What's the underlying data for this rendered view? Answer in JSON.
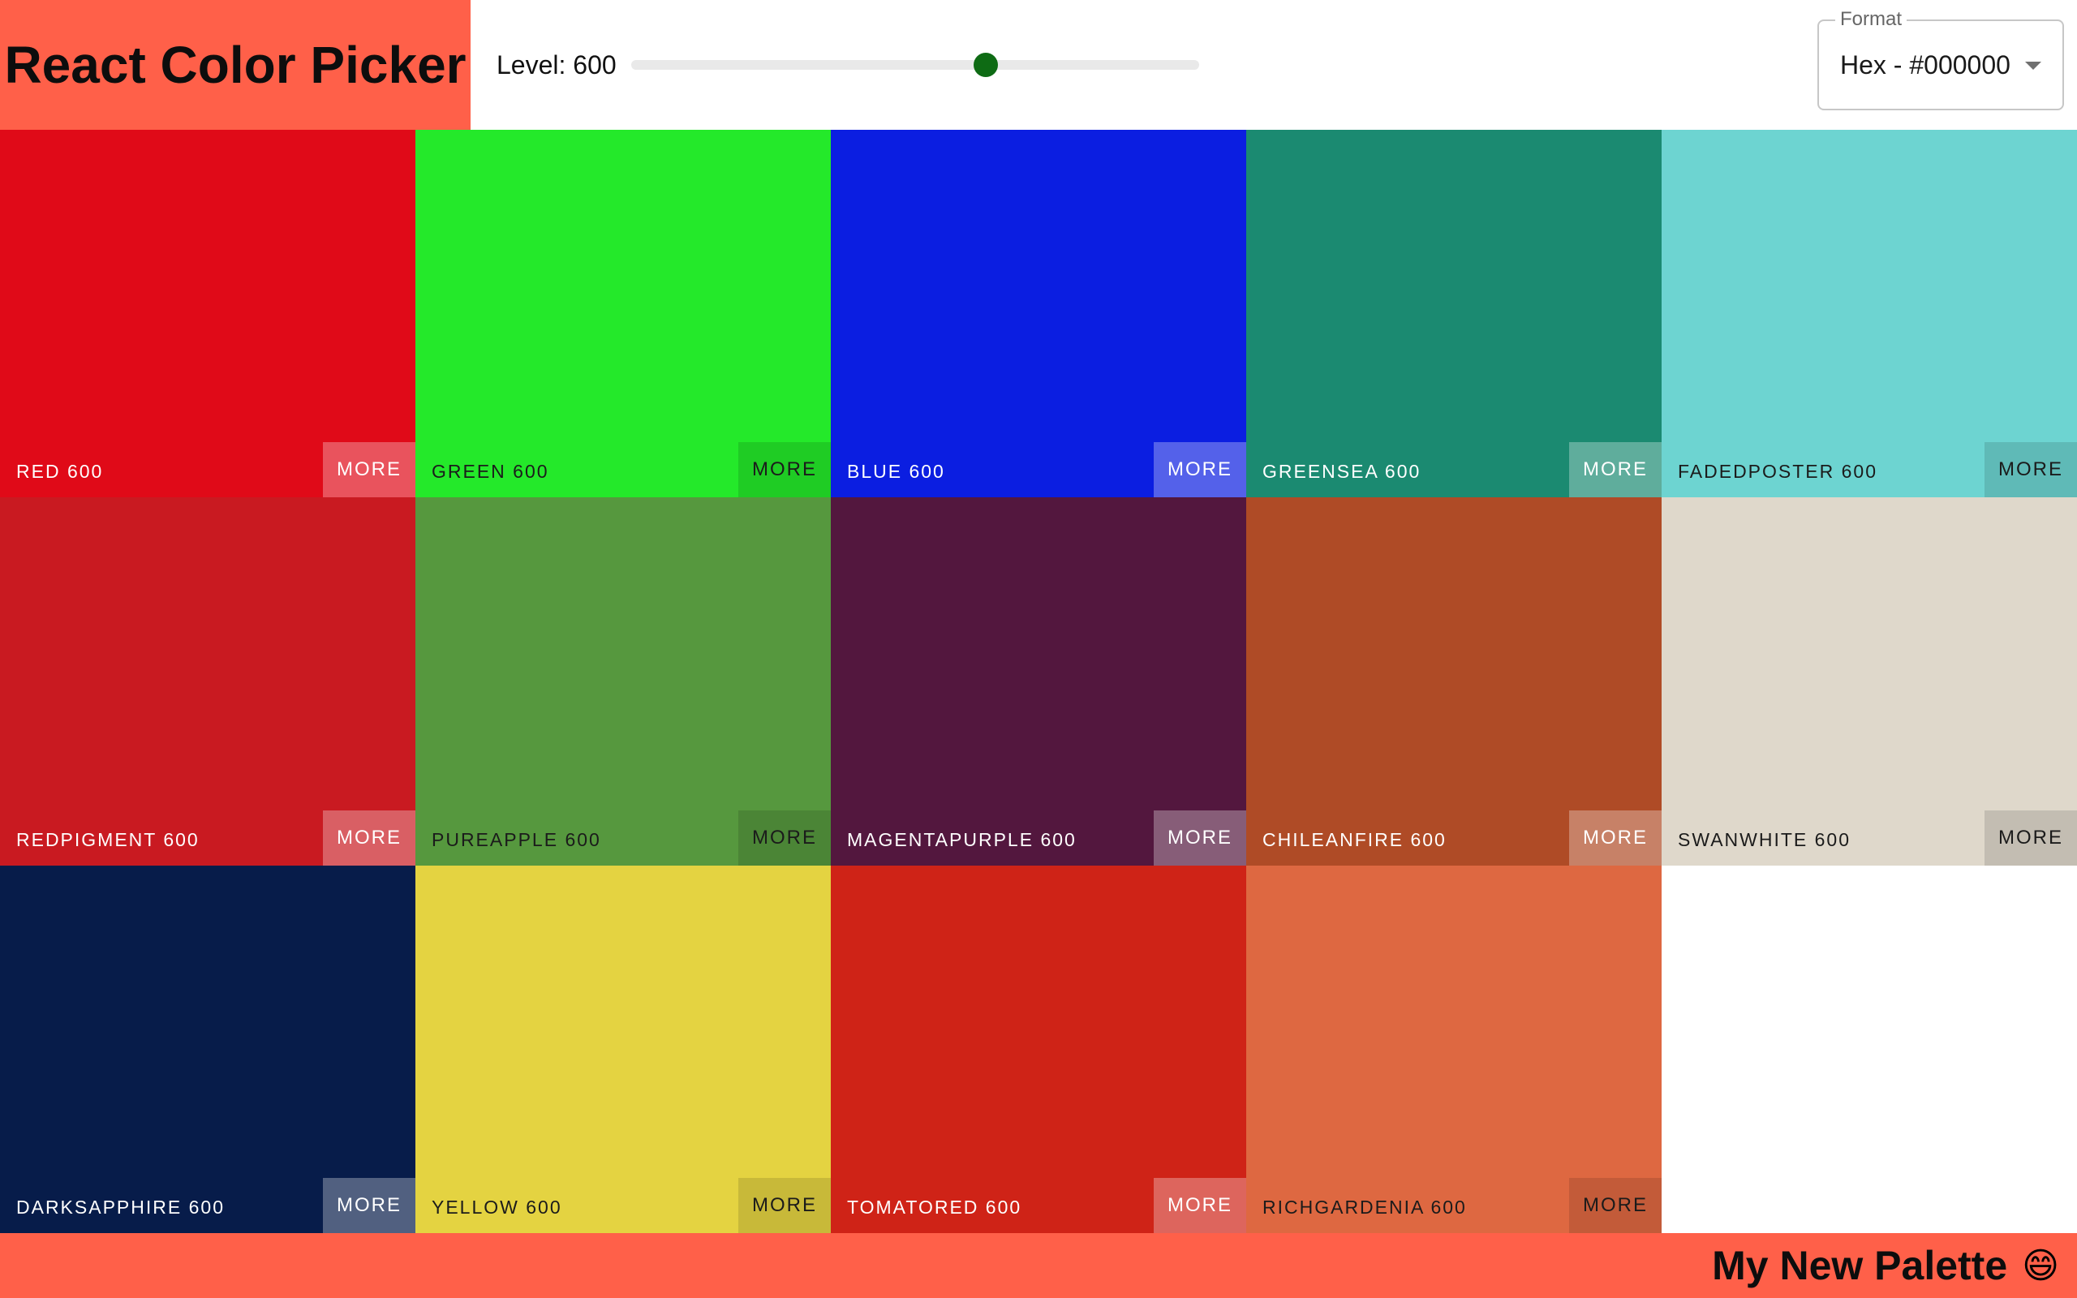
{
  "navbar": {
    "logo": "React Color Picker",
    "level_label": "Level: 600",
    "level_value": 600,
    "level_fraction": 0.625,
    "slider_thumb_color": "#0e6b14",
    "format_label": "Format",
    "format_value": "Hex - #000000"
  },
  "palette": {
    "more_label": "MORE",
    "colors": [
      {
        "name": "RED 600",
        "color": "#e00a18",
        "text": "dark"
      },
      {
        "name": "GREEN 600",
        "color": "#24e92a",
        "text": "light"
      },
      {
        "name": "BLUE 600",
        "color": "#0b1ee1",
        "text": "dark"
      },
      {
        "name": "GREENSEA 600",
        "color": "#1b8a71",
        "text": "dark"
      },
      {
        "name": "FADEDPOSTER 600",
        "color": "#6dd4d1",
        "text": "light"
      },
      {
        "name": "REDPIGMENT 600",
        "color": "#c91a21",
        "text": "dark"
      },
      {
        "name": "PUREAPPLE 600",
        "color": "#56983e",
        "text": "light"
      },
      {
        "name": "MAGENTAPURPLE 600",
        "color": "#53173e",
        "text": "dark"
      },
      {
        "name": "CHILEANFIRE 600",
        "color": "#af4b26",
        "text": "dark"
      },
      {
        "name": "SWANWHITE 600",
        "color": "#dfd8cb",
        "text": "light"
      },
      {
        "name": "DARKSAPPHIRE 600",
        "color": "#071c4a",
        "text": "dark"
      },
      {
        "name": "YELLOW 600",
        "color": "#e4d341",
        "text": "light"
      },
      {
        "name": "TOMATORED 600",
        "color": "#cf2317",
        "text": "dark"
      },
      {
        "name": "RICHGARDENIA 600",
        "color": "#de6841",
        "text": "light"
      }
    ]
  },
  "footer": {
    "title": "My New Palette",
    "emoji": "😄"
  },
  "theme": {
    "accent": "#ff6049"
  }
}
